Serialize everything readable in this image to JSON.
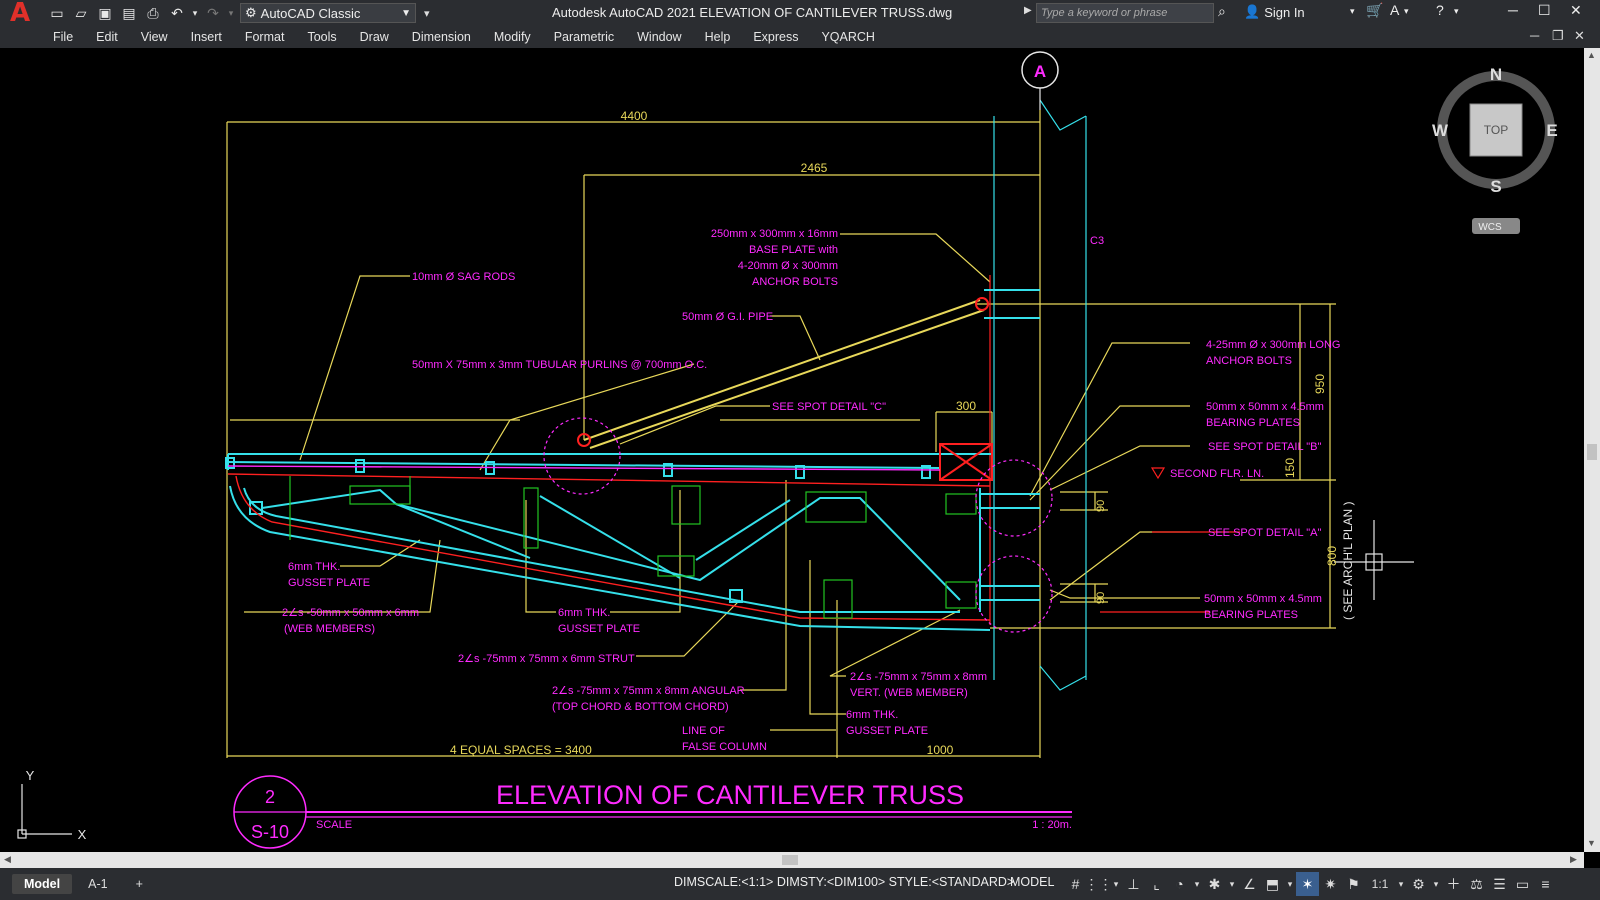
{
  "app": {
    "logo": "A",
    "title": "Autodesk AutoCAD 2021    ELEVATION OF CANTILEVER TRUSS.dwg",
    "workspace": "AutoCAD Classic",
    "search_placeholder": "Type a keyword or phrase",
    "sign_in": "Sign In"
  },
  "menu": [
    "File",
    "Edit",
    "View",
    "Insert",
    "Format",
    "Tools",
    "Draw",
    "Dimension",
    "Modify",
    "Parametric",
    "Window",
    "Help",
    "Express",
    "YQARCH"
  ],
  "viewcube": {
    "n": "N",
    "s": "S",
    "e": "E",
    "w": "W",
    "face": "TOP",
    "wcs": "WCS"
  },
  "ucs": {
    "x": "X",
    "y": "Y"
  },
  "drawing": {
    "grid_bubble": "A",
    "column_label": "C3",
    "dims": {
      "d4400": "4400",
      "d2465": "2465",
      "d300": "300",
      "d950": "950",
      "d150": "150",
      "d90a": "90",
      "d90b": "90",
      "d800": "800",
      "d1000": "1000",
      "spaces": "4  EQUAL  SPACES  =  3400"
    },
    "labels": {
      "base_plate": [
        "250mm x 300mm x 16mm",
        "BASE PLATE with",
        "4-20mm Ø x 300mm",
        "ANCHOR BOLTS"
      ],
      "sag_rods": "10mm Ø SAG RODS",
      "gi_pipe": "50mm Ø G.I. PIPE",
      "purlins": "50mm X 75mm x 3mm TUBULAR PURLINS @ 700mm O.C.",
      "spot_c": "SEE SPOT DETAIL \"C\"",
      "anchor_bolts": [
        "4-25mm Ø x 300mm LONG",
        "ANCHOR BOLTS"
      ],
      "bearing_top": [
        "50mm x 50mm x 4.5mm",
        "BEARING PLATES"
      ],
      "spot_b": "SEE SPOT DETAIL  \"B\"",
      "second_flr": "SECOND FLR. LN.",
      "spot_a": "SEE SPOT DETAIL \"A\"",
      "bearing_bot": [
        "50mm x 50mm x 4.5mm",
        "BEARING PLATES"
      ],
      "arch_plan": "( SEE ARCH'L  PLAN )",
      "gusset1": [
        "6mm THK.",
        "GUSSET PLATE"
      ],
      "web_members": [
        "2∠s -50mm x 50mm x 6mm",
        "(WEB MEMBERS)"
      ],
      "gusset2": [
        "6mm THK.",
        "GUSSET PLATE"
      ],
      "strut": "2∠s -75mm x 75mm x 6mm STRUT",
      "angular": [
        "2∠s -75mm x 75mm x 8mm ANGULAR",
        "(TOP CHORD & BOTTOM CHORD)"
      ],
      "vert_web": [
        "2∠s -75mm x 75mm x 8mm",
        "VERT. (WEB MEMBER)"
      ],
      "false_col": [
        "LINE OF",
        "FALSE COLUMN"
      ],
      "gusset3": [
        "6mm THK.",
        "GUSSET PLATE"
      ]
    },
    "title_block": {
      "num": "2",
      "sheet": "S-10",
      "title": "ELEVATION OF CANTILEVER TRUSS",
      "scale_label": "SCALE",
      "scale": "1 : 20m."
    }
  },
  "status": {
    "tabs": [
      "Model",
      "A-1",
      "+"
    ],
    "dimstat": "DIMSCALE:<1:1> DIMSTY:<DIM100> STYLE:<STANDARD>",
    "model": "MODEL",
    "scale": "1:1"
  },
  "colors": {
    "yellow": "#e8d85a",
    "magenta": "#ff2bff",
    "cyan": "#35e0ea",
    "red": "#ff2020",
    "green": "#22c422",
    "white": "#e6e6e6"
  }
}
